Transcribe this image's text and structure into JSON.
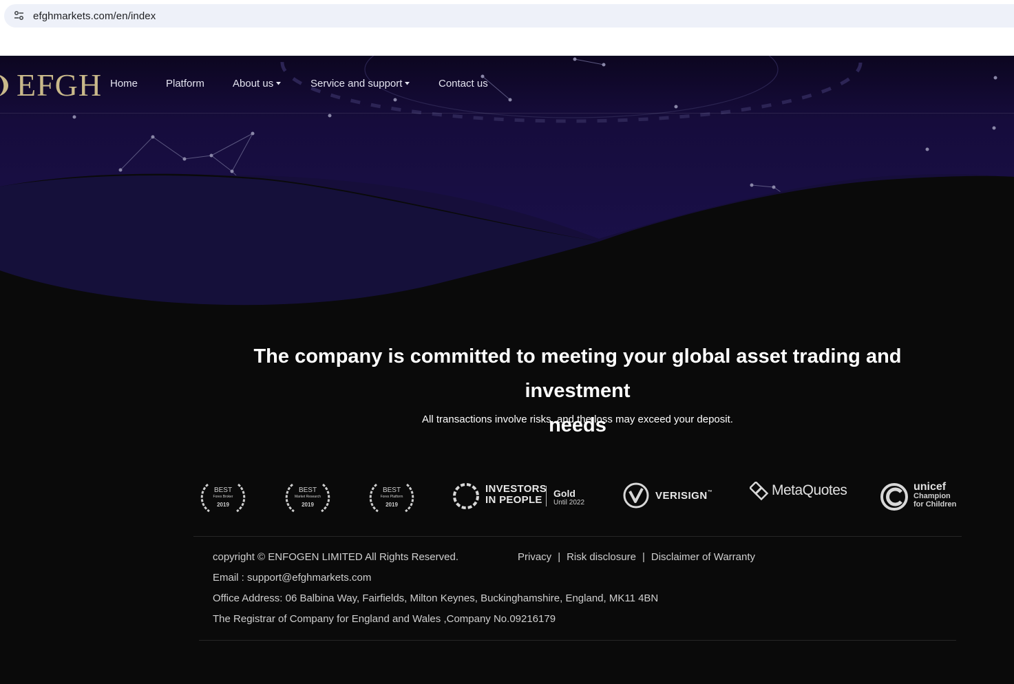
{
  "browser": {
    "url": "efghmarkets.com/en/index",
    "site_info_icon": "tune-icon"
  },
  "nav": {
    "logo": "EFGH",
    "items": [
      {
        "label": "Home",
        "has_dropdown": false
      },
      {
        "label": "Platform",
        "has_dropdown": false
      },
      {
        "label": "About us",
        "has_dropdown": true
      },
      {
        "label": "Service and support",
        "has_dropdown": true
      },
      {
        "label": "Contact us",
        "has_dropdown": false
      }
    ]
  },
  "hero": {
    "tagline_line1": "The company is committed to meeting your global asset trading and investment",
    "tagline_line2": "needs",
    "risk_warning": "All transactions involve risks, and the loss may exceed your deposit."
  },
  "badges": {
    "awards": [
      {
        "title": "BEST",
        "subtitle": "Forex Broker",
        "year": "2019"
      },
      {
        "title": "BEST",
        "subtitle": "Market Research",
        "year": "2019"
      },
      {
        "title": "BEST",
        "subtitle": "Forex Platform",
        "year": "2019"
      }
    ],
    "investors_in_people": {
      "line1": "INVESTORS",
      "line2": "IN PEOPLE",
      "level": "Gold",
      "until": "Until 2022"
    },
    "verisign": "VERISIGN",
    "verisign_mark": "™",
    "metaquotes": "MetaQuotes",
    "unicef": {
      "name": "unicef",
      "line1": "Champion",
      "line2": "for Children"
    }
  },
  "footer": {
    "copyright": "copyright © ENFOGEN LIMITED All Rights Reserved.",
    "links": [
      "Privacy",
      "Risk disclosure",
      "Disclaimer of Warranty"
    ],
    "separator": "|",
    "email": "Email : support@efghmarkets.com",
    "address": "Office Address: 06 Balbina Way, Fairfields, Milton Keynes, Buckinghamshire, England, MK11 4BN",
    "registrar": "The Registrar of Company for England and Wales ,Company No.09216179"
  },
  "colors": {
    "page_bg": "#0a0a0a",
    "hero_purple": "#1a0f4a",
    "logo_gold": "#c9b98a",
    "nav_text": "#e4e4f0"
  }
}
